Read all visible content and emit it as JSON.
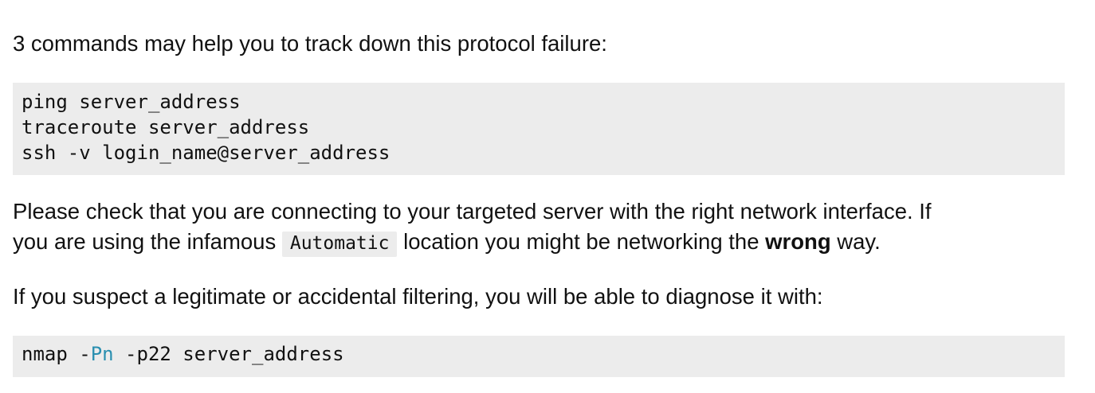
{
  "intro": {
    "text": "3 commands may help you to track down this protocol failure:"
  },
  "commands": [
    "ping server_address",
    "traceroute server_address",
    "ssh -v login_name@server_address"
  ],
  "interface_note": {
    "line1": "Please check that you are connecting to your targeted server with the right network interface. If",
    "line2_before": "you are using the infamous ",
    "inline_code": "Automatic",
    "line2_middle": " location you might be networking the ",
    "emphasis": "wrong",
    "line2_after": " way."
  },
  "filter_note": {
    "text": "If you suspect a legitimate or accidental filtering, you will be able to diagnose it with:"
  },
  "nmap_command": {
    "before": "nmap -",
    "flag": "Pn",
    "after": " -p22 server_address"
  }
}
